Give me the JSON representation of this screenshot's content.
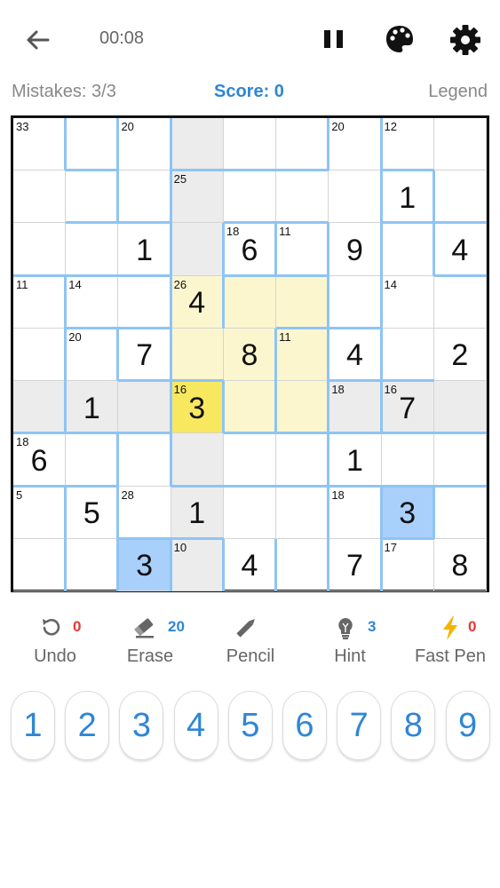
{
  "header": {
    "timer": "00:08",
    "icons": [
      "back-arrow-icon",
      "pause-icon",
      "palette-icon",
      "gear-icon"
    ]
  },
  "status": {
    "mistakes": "Mistakes: 3/3",
    "score": "Score: 0",
    "legend": "Legend"
  },
  "board": {
    "values": [
      [
        "",
        "",
        "",
        "",
        "",
        "",
        "",
        "",
        ""
      ],
      [
        "",
        "",
        "",
        "",
        "",
        "",
        "",
        "1",
        ""
      ],
      [
        "",
        "",
        "1",
        "",
        "6",
        "",
        "9",
        "",
        "4"
      ],
      [
        "",
        "",
        "",
        "4",
        "",
        "",
        "",
        "",
        ""
      ],
      [
        "",
        "",
        "7",
        "",
        "8",
        "",
        "4",
        "",
        "2"
      ],
      [
        "",
        "1",
        "",
        "3",
        "",
        "",
        "",
        "7",
        ""
      ],
      [
        "6",
        "",
        "",
        "",
        "",
        "",
        "1",
        "",
        ""
      ],
      [
        "",
        "5",
        "",
        "1",
        "",
        "",
        "",
        "3",
        ""
      ],
      [
        "",
        "",
        "3",
        "",
        "4",
        "",
        "7",
        "",
        "8"
      ]
    ],
    "cage_sums": [
      {
        "r": 0,
        "c": 0,
        "sum": "33"
      },
      {
        "r": 0,
        "c": 2,
        "sum": "20"
      },
      {
        "r": 0,
        "c": 6,
        "sum": "20"
      },
      {
        "r": 0,
        "c": 7,
        "sum": "12"
      },
      {
        "r": 1,
        "c": 3,
        "sum": "25"
      },
      {
        "r": 2,
        "c": 4,
        "sum": "18"
      },
      {
        "r": 2,
        "c": 5,
        "sum": "11"
      },
      {
        "r": 3,
        "c": 0,
        "sum": "11"
      },
      {
        "r": 3,
        "c": 1,
        "sum": "14"
      },
      {
        "r": 3,
        "c": 3,
        "sum": "26"
      },
      {
        "r": 3,
        "c": 7,
        "sum": "14"
      },
      {
        "r": 4,
        "c": 1,
        "sum": "20"
      },
      {
        "r": 4,
        "c": 5,
        "sum": "11"
      },
      {
        "r": 5,
        "c": 3,
        "sum": "16"
      },
      {
        "r": 5,
        "c": 6,
        "sum": "18"
      },
      {
        "r": 5,
        "c": 7,
        "sum": "16"
      },
      {
        "r": 6,
        "c": 0,
        "sum": "18"
      },
      {
        "r": 7,
        "c": 0,
        "sum": "5"
      },
      {
        "r": 7,
        "c": 2,
        "sum": "28"
      },
      {
        "r": 7,
        "c": 6,
        "sum": "18"
      },
      {
        "r": 8,
        "c": 3,
        "sum": "10"
      },
      {
        "r": 8,
        "c": 7,
        "sum": "17"
      }
    ],
    "selected": {
      "r": 5,
      "c": 3
    },
    "same_number_cells": [
      {
        "r": 7,
        "c": 7
      },
      {
        "r": 8,
        "c": 2
      }
    ],
    "colors": {
      "selected": "#f8e860",
      "row_col": "#ececec",
      "box": "#fcf6cf",
      "same_number": "#a9d0fb",
      "cage": "#8ec4f4",
      "accent": "#2f86d6"
    }
  },
  "tools": [
    {
      "label": "Undo",
      "count": "0",
      "count_color": "#e53935",
      "icon": "undo-icon"
    },
    {
      "label": "Erase",
      "count": "20",
      "count_color": "#2f86d6",
      "icon": "eraser-icon"
    },
    {
      "label": "Pencil",
      "count": "",
      "count_color": "#2f86d6",
      "icon": "pencil-icon"
    },
    {
      "label": "Hint",
      "count": "3",
      "count_color": "#2f86d6",
      "icon": "lightbulb-icon"
    },
    {
      "label": "Fast Pen",
      "count": "0",
      "count_color": "#e53935",
      "icon": "lightning-icon"
    }
  ],
  "numpad": [
    "1",
    "2",
    "3",
    "4",
    "5",
    "6",
    "7",
    "8",
    "9"
  ]
}
